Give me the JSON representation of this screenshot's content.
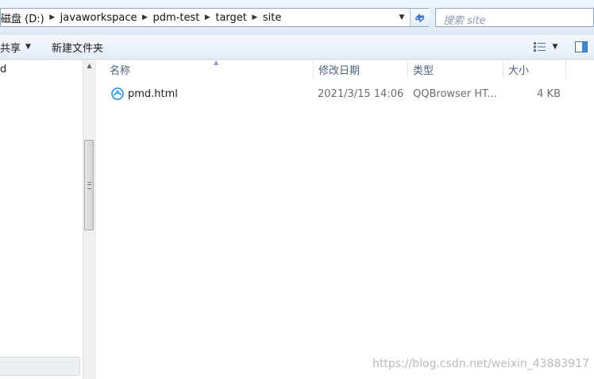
{
  "address_bar": {
    "breadcrumbs": [
      "磁盘 (D:)",
      "javaworkspace",
      "pdm-test",
      "target",
      "site"
    ]
  },
  "search": {
    "placeholder": "搜索 site"
  },
  "toolbar": {
    "share_label": "共享",
    "new_folder_label": "新建文件夹"
  },
  "nav_pane": {
    "partial_item": "d"
  },
  "columns": {
    "name": "名称",
    "date_modified": "修改日期",
    "type": "类型",
    "size": "大小"
  },
  "files": [
    {
      "name": "pmd.html",
      "date_modified": "2021/3/15 14:06",
      "type": "QQBrowser HT...",
      "size": "4 KB",
      "icon": "browser-html-icon"
    }
  ],
  "watermark": "https://blog.csdn.net/weixin_43883917",
  "colors": {
    "accent": "#1f8fe0",
    "header_text": "#4c607a",
    "toolbar_bg": "#e4edf8"
  }
}
